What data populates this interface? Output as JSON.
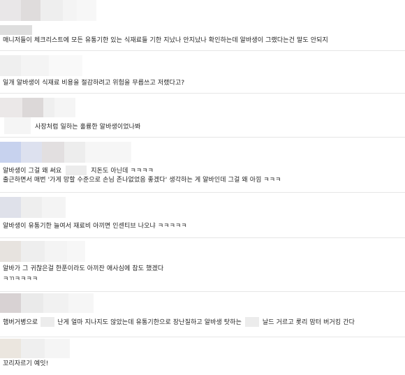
{
  "comments": [
    {
      "texts": [
        "매니저들이 체크리스트에 모든 유통기한 있는 식재료들 기한 지났나 안지났나 확인하는데 알바생이 그랬다는건 말도 안되지"
      ]
    },
    {
      "texts": [
        "일개 알바생이 식재료 비용을 절감하려고 위험을 무릅쓰고 저랬다고?"
      ]
    },
    {
      "texts": [
        "사장처럼 일하는 훌륭한 알바생이었나봐"
      ]
    },
    {
      "texts": [
        "알바생이 그걸 왜 써요",
        "지돈도 아닌데 ㅋㅋㅋㅋ",
        "출근하면서 매번 '가게 망할 수준으로 손님 존나없었음 좋겠다' 생각하는 게 알바인데 그걸 왜 아낌 ㅋㅋㅋ"
      ]
    },
    {
      "texts": [
        "알바생이 유통기한 늘여서 재료비 아끼면 인센티브 나오냐 ㅋㅋㅋㅋㅋ"
      ]
    },
    {
      "texts": [
        "알바가 그 귀찮은걸 한푼이라도 아끼잔 애사심에 참도 했겠다",
        "ㅋㄲㅋㅋㅋㅋ"
      ]
    },
    {
      "texts": [
        "햄버거병으로",
        "난게 얼마 지나지도 않았는데 유통기한으로 장난질하고 알바생 탓하는",
        "날드 거르고 롯리 맘터 버거킹 간다"
      ]
    },
    {
      "texts": [
        "꼬리자르기 예잇!"
      ]
    }
  ]
}
